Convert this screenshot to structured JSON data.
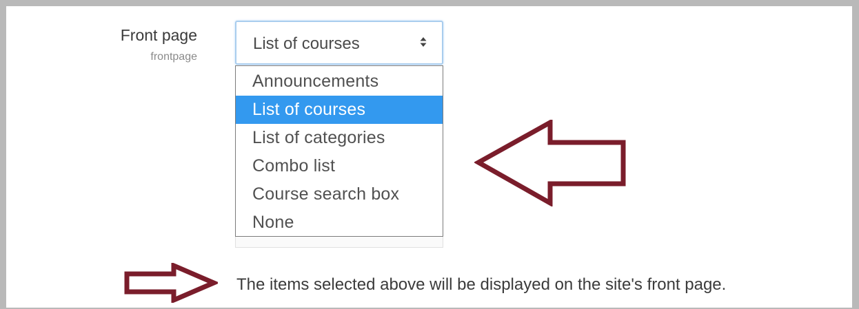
{
  "setting": {
    "title": "Front page",
    "key": "frontpage"
  },
  "select": {
    "current_value": "List of courses",
    "caret_icon": "up-down-caret-icon",
    "options": [
      {
        "label": "Announcements",
        "selected": false
      },
      {
        "label": "List of courses",
        "selected": true
      },
      {
        "label": "List of categories",
        "selected": false
      },
      {
        "label": "Combo list",
        "selected": false
      },
      {
        "label": "Course search box",
        "selected": false
      },
      {
        "label": "None",
        "selected": false
      }
    ]
  },
  "help": {
    "text": "The items selected above will be displayed on the site's front page."
  },
  "annotations": {
    "arrow_color": "#7a1d2b",
    "big_arrow": "left-arrow-icon",
    "small_arrow": "right-arrow-icon"
  },
  "colors": {
    "selected_bg": "#3399ef",
    "focus_border": "#a9cdee"
  }
}
